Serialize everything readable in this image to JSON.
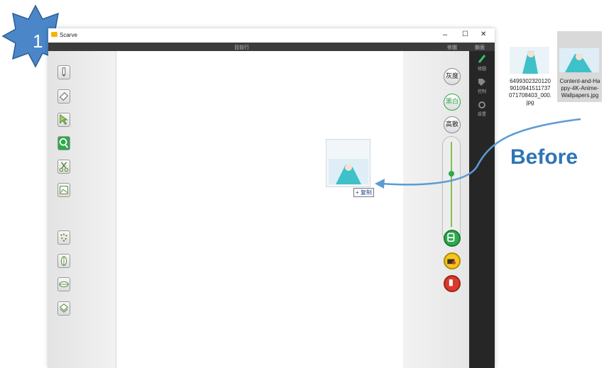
{
  "step": {
    "number": "1"
  },
  "window": {
    "title": "Scarve",
    "controls": {
      "minimize": "–",
      "maximize": "☐",
      "close": "✕"
    },
    "toolbar_strip": {
      "center": "目前行",
      "right_a": "修圖",
      "right_b": "鎖面"
    }
  },
  "left_tools": [
    "pencil-icon",
    "eraser-icon",
    "text-select-icon",
    "zoom-icon",
    "scissors-icon",
    "image-icon",
    "scatter-icon",
    "leaf-icon",
    "eye-icon",
    "layers-icon"
  ],
  "right_buttons": {
    "gray": "灰度",
    "bw": "黑白",
    "contrast": "高散"
  },
  "side_labels": {
    "edit": "修圖",
    "control": "控制",
    "settings": "設置"
  },
  "drag": {
    "label": "+ 复制"
  },
  "desktop_files": [
    {
      "name": "6499302320120\n9010941511737\n071708403_000.\njpg"
    },
    {
      "name": "Content-and-Ha\nppy-4K-Anime-\nWallpapers.jpg"
    }
  ],
  "annotation": {
    "text": "Before"
  },
  "colors": {
    "accent": "#2e75b6",
    "badge": "#4a86c8",
    "green": "#2fa84f",
    "red": "#d93a2b"
  }
}
